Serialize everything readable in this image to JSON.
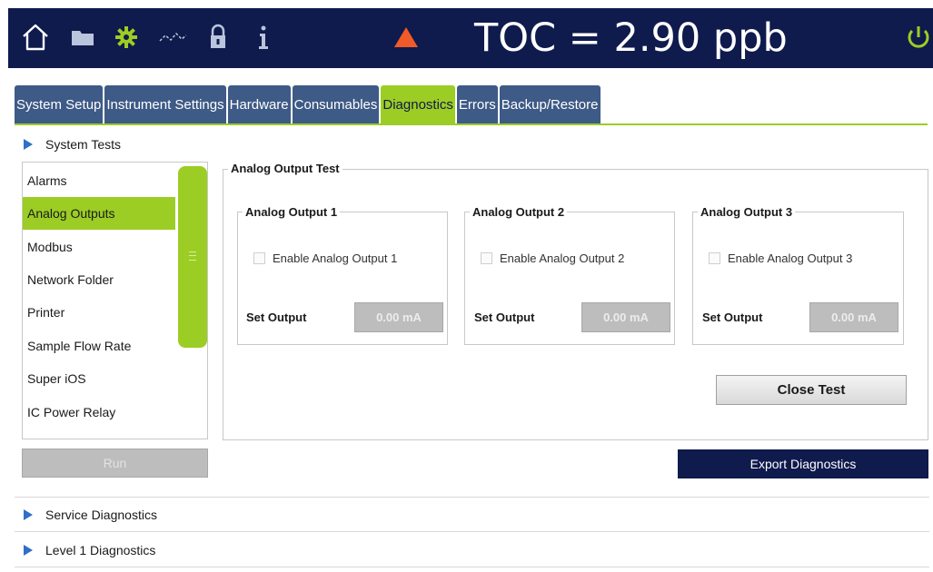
{
  "header": {
    "toc_readout": "TOC = 2.90 ppb",
    "icons": [
      "home-icon",
      "folder-icon",
      "gear-icon",
      "trend-icon",
      "lock-icon",
      "info-icon",
      "warning-icon",
      "power-icon"
    ],
    "colors": {
      "bar": "#0f1a4d",
      "accent": "#9ccd24",
      "warning": "#f15a29"
    }
  },
  "tabs": [
    {
      "label": "System Setup"
    },
    {
      "label": "Instrument Settings"
    },
    {
      "label": "Hardware"
    },
    {
      "label": "Consumables"
    },
    {
      "label": "Diagnostics",
      "active": true
    },
    {
      "label": "Errors"
    },
    {
      "label": "Backup/Restore"
    }
  ],
  "sections": {
    "system_tests": "System Tests",
    "service_diagnostics": "Service Diagnostics",
    "level1_diagnostics": "Level 1 Diagnostics"
  },
  "test_list": {
    "items": [
      {
        "label": "Alarms"
      },
      {
        "label": "Analog Outputs",
        "active": true
      },
      {
        "label": "Modbus"
      },
      {
        "label": "Network Folder"
      },
      {
        "label": "Printer"
      },
      {
        "label": "Sample Flow Rate"
      },
      {
        "label": "Super iOS"
      },
      {
        "label": "IC Power Relay"
      }
    ],
    "run_label": "Run"
  },
  "analog_test": {
    "title": "Analog Output Test",
    "outputs": [
      {
        "title": "Analog Output 1",
        "enable_label": "Enable Analog Output  1",
        "set_label": "Set Output",
        "value": "0.00 mA"
      },
      {
        "title": "Analog Output 2",
        "enable_label": "Enable Analog Output  2",
        "set_label": "Set Output",
        "value": "0.00 mA"
      },
      {
        "title": "Analog Output 3",
        "enable_label": "Enable Analog Output  3",
        "set_label": "Set Output",
        "value": "0.00 mA"
      }
    ],
    "close_label": "Close Test"
  },
  "export_label": "Export Diagnostics"
}
